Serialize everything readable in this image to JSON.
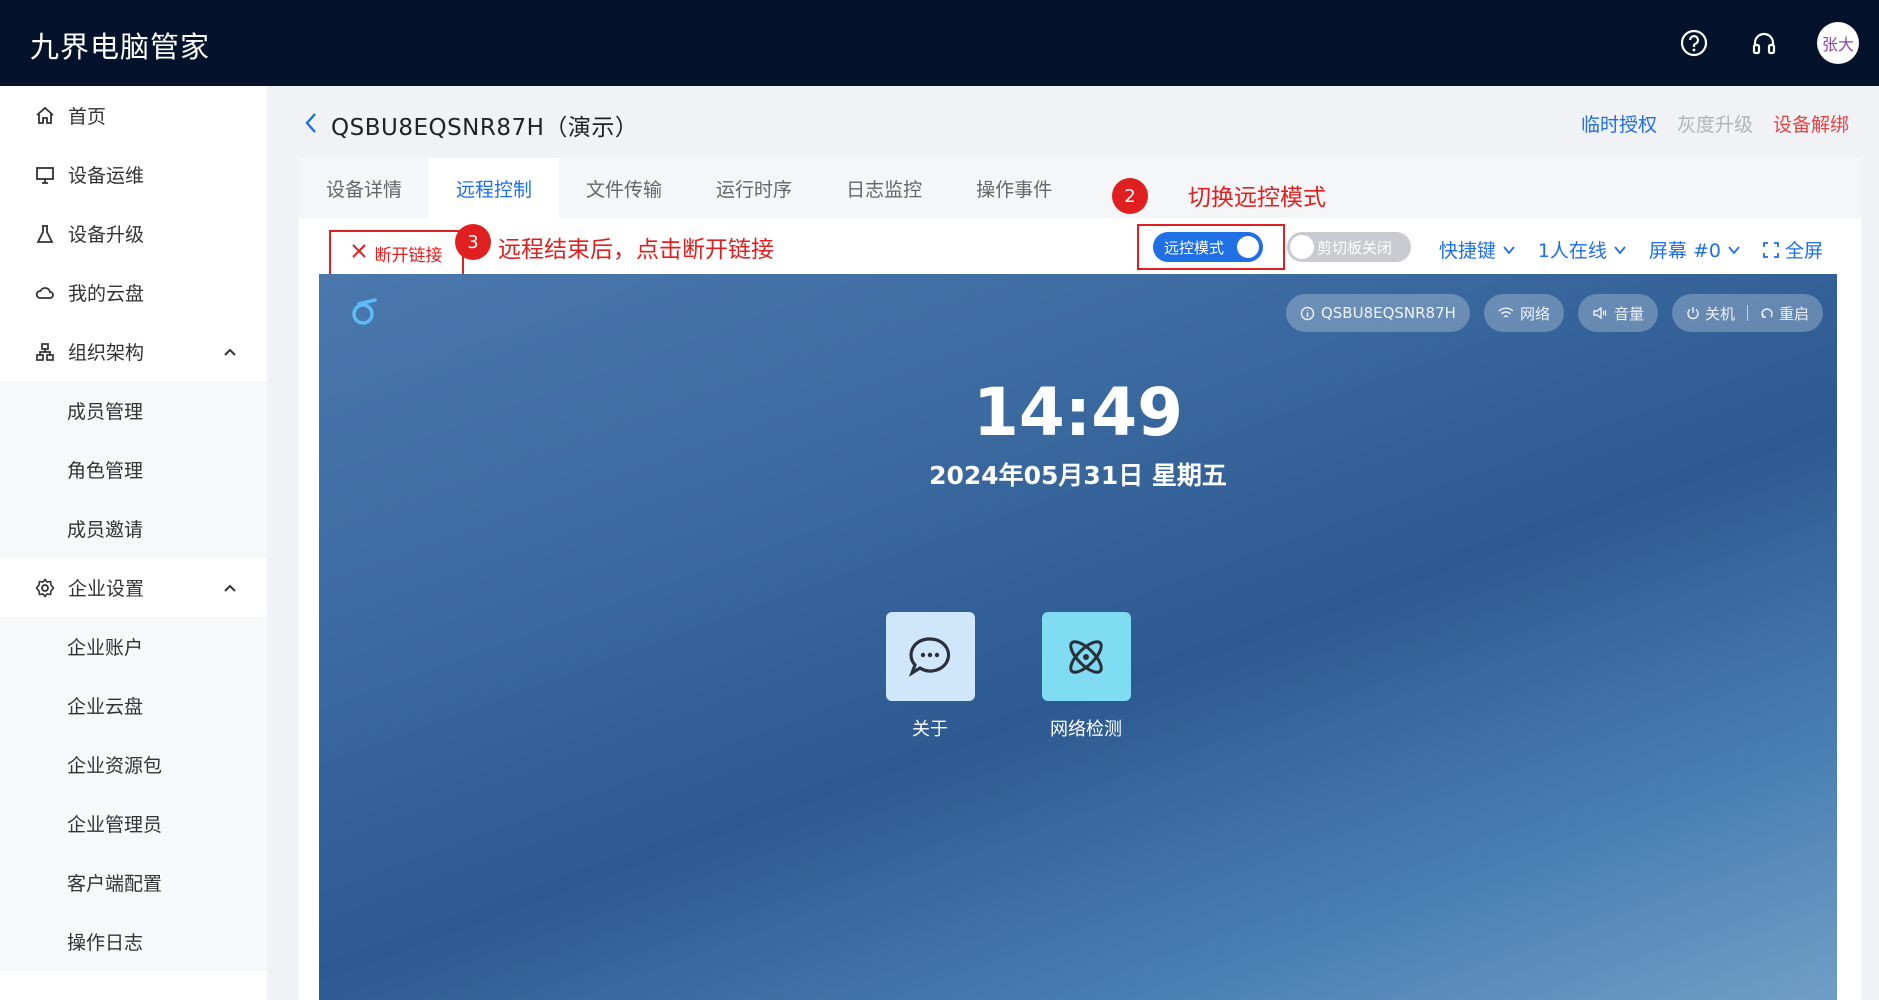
{
  "app": {
    "title": "九界电脑管家"
  },
  "topbar": {
    "help_icon": "question-circle-icon",
    "support_icon": "headset-icon",
    "avatar_text": "张大"
  },
  "sidebar": {
    "items": [
      {
        "label": "首页",
        "icon": "home-icon"
      },
      {
        "label": "设备运维",
        "icon": "monitor-icon"
      },
      {
        "label": "设备升级",
        "icon": "flask-icon"
      },
      {
        "label": "我的云盘",
        "icon": "cloud-icon"
      },
      {
        "label": "组织架构",
        "icon": "org-chart-icon"
      }
    ],
    "org_sub": [
      "成员管理",
      "角色管理",
      "成员邀请"
    ],
    "settings": {
      "label": "企业设置",
      "icon": "gear-icon"
    },
    "settings_sub": [
      "企业账户",
      "企业云盘",
      "企业资源包",
      "企业管理员",
      "客户端配置",
      "操作日志"
    ]
  },
  "header": {
    "device_title": "QSBU8EQSNR87H（演示）",
    "actions": {
      "temp_auth": "临时授权",
      "gray_upgrade": "灰度升级",
      "unbind": "设备解绑"
    }
  },
  "tabs": [
    "设备详情",
    "远程控制",
    "文件传输",
    "运行时序",
    "日志监控",
    "操作事件"
  ],
  "active_tab": "远程控制",
  "toolbar": {
    "disconnect_label": "断开链接",
    "mode_toggle_label": "远控模式",
    "clipboard_toggle_label": "剪切板关闭",
    "shortcut_label": "快捷键",
    "online_label": "1人在线",
    "screen_label": "屏幕 #0",
    "fullscreen_label": "全屏"
  },
  "annotations": {
    "step2_num": "2",
    "step2_text": "切换远控模式",
    "step3_num": "3",
    "step3_text": "远程结束后，点击断开链接"
  },
  "remote_screen": {
    "pills": {
      "device_id": "QSBU8EQSNR87H",
      "network": "网络",
      "volume": "音量",
      "shutdown": "关机",
      "restart": "重启"
    },
    "time": "14:49",
    "date": "2024年05月31日 星期五",
    "apps": [
      {
        "label": "关于",
        "icon": "chat-bubble-icon"
      },
      {
        "label": "网络检测",
        "icon": "atom-icon"
      }
    ]
  },
  "colors": {
    "topbar": "#04132b",
    "accent": "#1f6fe5",
    "danger": "#e02020"
  }
}
